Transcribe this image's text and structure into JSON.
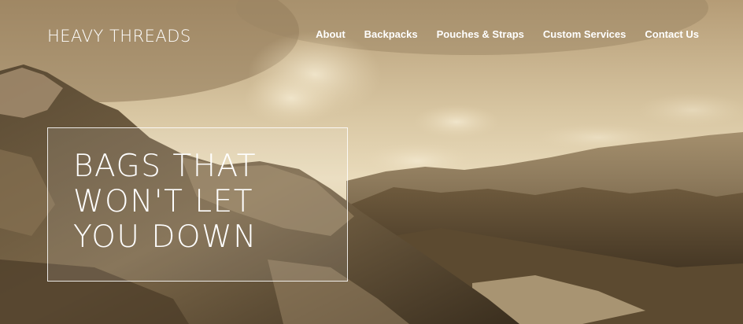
{
  "site": {
    "logo_text": "HEAVY THREADS"
  },
  "nav": {
    "items": [
      {
        "label": "About"
      },
      {
        "label": "Backpacks"
      },
      {
        "label": "Pouches & Straps"
      },
      {
        "label": "Custom Services"
      },
      {
        "label": "Contact Us"
      }
    ]
  },
  "hero": {
    "headline_lines": [
      "BAGS THAT",
      "WON'T LET",
      "YOU DOWN"
    ],
    "background": "sepia mountain landscape with clouds"
  },
  "colors": {
    "text": "#ffffff",
    "sepia_light": "#e6d6b4",
    "sepia_mid": "#a48c66",
    "sepia_dark": "#3e3120"
  }
}
